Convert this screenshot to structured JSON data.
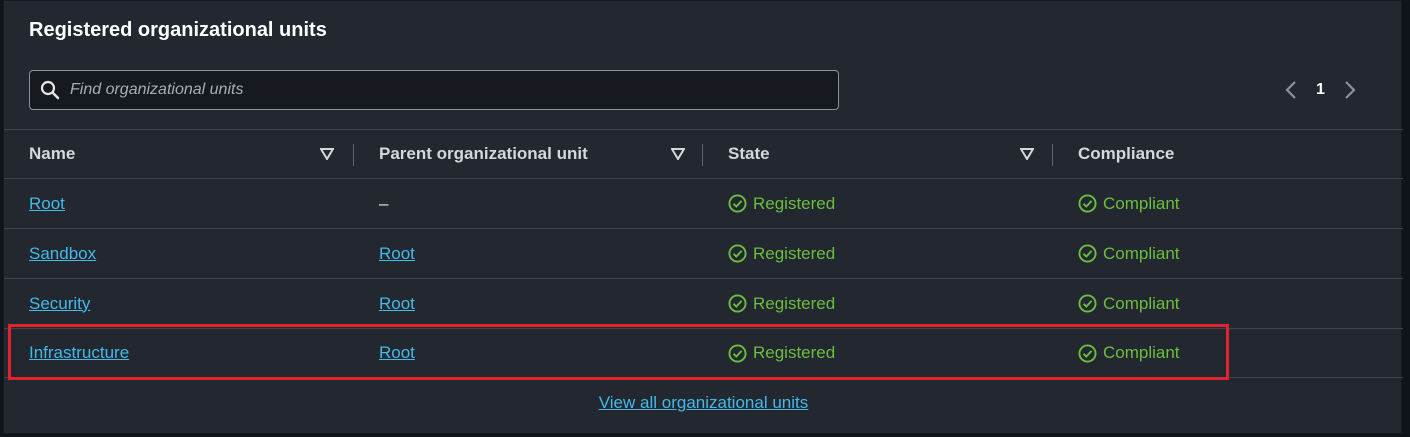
{
  "header": {
    "title": "Registered organizational units"
  },
  "search": {
    "placeholder": "Find organizational units",
    "value": ""
  },
  "pagination": {
    "current_page": "1"
  },
  "table": {
    "columns": [
      "Name",
      "Parent organizational unit",
      "State",
      "Compliance"
    ],
    "rows": [
      {
        "name": "Root",
        "parent": "–",
        "state": "Registered",
        "compliance": "Compliant"
      },
      {
        "name": "Sandbox",
        "parent": "Root",
        "state": "Registered",
        "compliance": "Compliant"
      },
      {
        "name": "Security",
        "parent": "Root",
        "state": "Registered",
        "compliance": "Compliant"
      },
      {
        "name": "Infrastructure",
        "parent": "Root",
        "state": "Registered",
        "compliance": "Compliant"
      }
    ]
  },
  "footer": {
    "view_all_label": "View all organizational units"
  },
  "colors": {
    "background": "#222730",
    "link": "#44b9e8",
    "success": "#6bbe3e",
    "highlight": "#e3232c"
  },
  "icons": {
    "search": "search-icon",
    "sort": "sort-caret-icon",
    "status": "check-circle-icon",
    "prev": "chevron-left-icon",
    "next": "chevron-right-icon"
  }
}
